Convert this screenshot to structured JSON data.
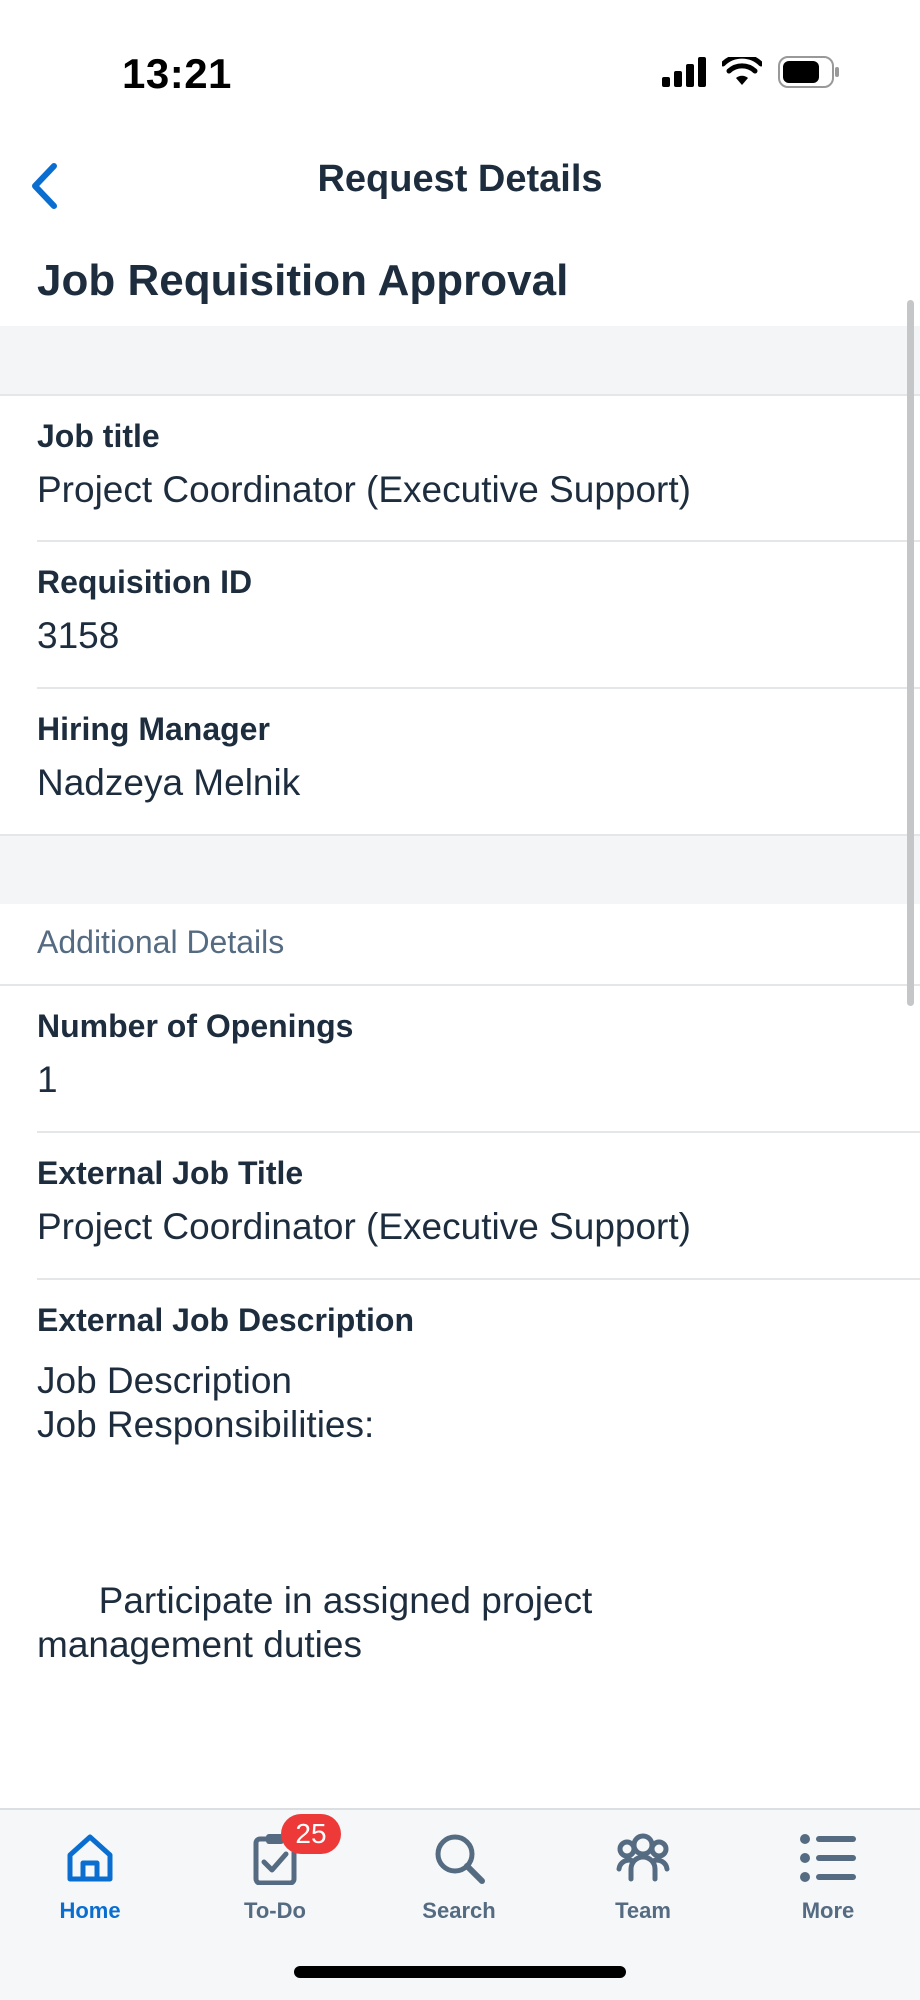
{
  "status_bar": {
    "time": "13:21"
  },
  "nav": {
    "title": "Request Details"
  },
  "page": {
    "title": "Job Requisition Approval"
  },
  "fields": [
    {
      "label": "Job title",
      "value": "Project Coordinator (Executive Support)"
    },
    {
      "label": "Requisition ID",
      "value": "3158"
    },
    {
      "label": "Hiring Manager",
      "value": "Nadzeya Melnik"
    }
  ],
  "additional": {
    "heading": "Additional Details",
    "fields": [
      {
        "label": "Number of Openings",
        "value": "1"
      },
      {
        "label": "External Job Title",
        "value": "Project Coordinator (Executive Support)"
      }
    ],
    "description": {
      "label": "External Job Description",
      "lines": [
        "Job Description",
        "Job Responsibilities:",
        "",
        "",
        "",
        "      Participate in assigned project",
        "management duties"
      ]
    }
  },
  "tab_bar": {
    "tabs": [
      {
        "label": "Home",
        "icon": "home-icon",
        "active": true
      },
      {
        "label": "To-Do",
        "icon": "clipboard-check-icon",
        "badge": "25"
      },
      {
        "label": "Search",
        "icon": "search-icon"
      },
      {
        "label": "Team",
        "icon": "team-icon"
      },
      {
        "label": "More",
        "icon": "list-icon"
      }
    ]
  },
  "colors": {
    "accent": "#0a6ed1",
    "text": "#1d2d3e",
    "muted": "#556b82",
    "badge": "#ee3939"
  }
}
